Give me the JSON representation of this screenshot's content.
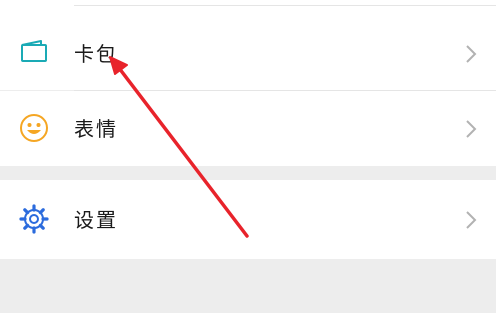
{
  "menu": {
    "items": [
      {
        "label": "卡包",
        "icon": "card-wallet-icon"
      },
      {
        "label": "表情",
        "icon": "smiley-face-icon"
      },
      {
        "label": "设置",
        "icon": "gear-icon"
      }
    ]
  },
  "colors": {
    "card_icon": "#1aaab5",
    "smiley_icon": "#f5a623",
    "settings_icon": "#2b6bdd",
    "chevron": "#b2b2b2",
    "annotation_arrow": "#e8232b",
    "page_background": "#ededed"
  },
  "annotation": {
    "type": "arrow",
    "points_to": "卡包"
  }
}
